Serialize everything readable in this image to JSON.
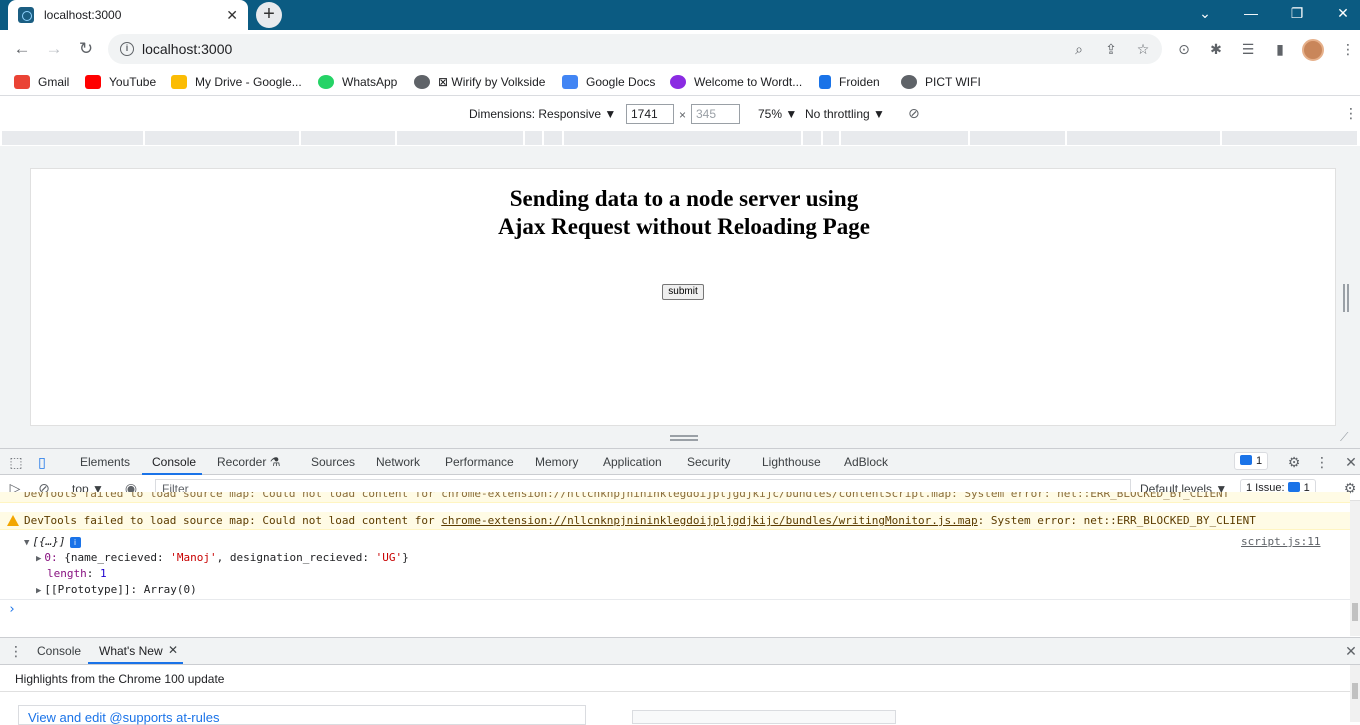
{
  "browser": {
    "tab_title": "localhost:3000",
    "tab_close": "✕",
    "new_tab": "+",
    "url": "localhost:3000",
    "window_buttons": {
      "dropdown": "⌄",
      "minimize": "—",
      "restore": "❐",
      "close": "✕"
    }
  },
  "bookmarks": [
    {
      "label": "Gmail",
      "color": "#ea4335"
    },
    {
      "label": "YouTube",
      "color": "#ff0000"
    },
    {
      "label": "My Drive - Google...",
      "color": "#fbbc04"
    },
    {
      "label": "WhatsApp",
      "color": "#25d366"
    },
    {
      "label": "⊠ Wirify by Volkside",
      "color": "#5f6368"
    },
    {
      "label": "Google Docs",
      "color": "#4285f4"
    },
    {
      "label": "Welcome to Wordt...",
      "color": "#8a2be2"
    },
    {
      "label": "Froiden",
      "color": "#1a73e8"
    },
    {
      "label": "PICT WIFI",
      "color": "#5f6368"
    }
  ],
  "device_toolbar": {
    "dimensions_label": "Dimensions: Responsive ▼",
    "width": "1741",
    "times": "×",
    "height_placeholder": "345",
    "zoom": "75% ▼",
    "throttling": "No throttling ▼"
  },
  "page": {
    "heading": "Sending data to a node server using Ajax Request without Reloading Page",
    "submit_label": "submit"
  },
  "devtools": {
    "tabs": [
      "Elements",
      "Console",
      "Recorder ⚗",
      "Sources",
      "Network",
      "Performance",
      "Memory",
      "Application",
      "Security",
      "Lighthouse",
      "AdBlock"
    ],
    "active_tab": "Console",
    "message_count": "1",
    "console_toolbar": {
      "context": "top ▼",
      "filter_placeholder": "Filter",
      "levels": "Default levels ▼",
      "issues_label": "1 Issue:",
      "issues_count": "1"
    },
    "console": {
      "warning_top_partial": "DevTools failed to load source map: Could not load content for chrome-extension://nllcnknpjnininklegdoijpljgdjkijc/bundles/contentScript.map: System error: net::ERR_BLOCKED_BY_CLIENT",
      "warning_prefix": "DevTools failed to load source map: Could not load content for ",
      "warning_link": "chrome-extension://nllcnknpjnininklegdoijpljgdjkijc/bundles/writingMonitor.js.map",
      "warning_suffix": ": System error: net::ERR_BLOCKED_BY_CLIENT",
      "log_summary": "[{…}]",
      "log_source": "script.js:11",
      "item_index": "0:",
      "item_open": " {",
      "key1": "name_recieved",
      "val1": "'Manoj'",
      "key2": "designation_recieved",
      "val2": "'UG'",
      "item_close": "}",
      "length_key": "length",
      "length_val": "1",
      "proto": "[[Prototype]]: Array(0)",
      "prompt": "›"
    },
    "drawer": {
      "tabs": [
        "Console",
        "What's New"
      ],
      "active_tab": "What's New",
      "highlights": "Highlights from the Chrome 100 update",
      "link": "View and edit @supports at-rules"
    }
  }
}
